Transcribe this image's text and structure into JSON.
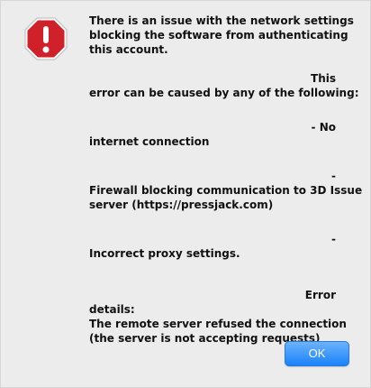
{
  "icon": {
    "name": "stop-alert-icon",
    "color": "#d0202a"
  },
  "message": {
    "intro": [
      "There is an issue with the network settings",
      "blocking the software from authenticating",
      "this account."
    ],
    "causes_tail": "This",
    "causes_head": "error can be caused by any of the following:",
    "item1_tail": "- No",
    "item1_head": "internet connection",
    "item2_tail": "-",
    "item2_head": [
      "Firewall blocking communication to 3D Issue",
      "server (https://pressjack.com)"
    ],
    "item3_tail": "-",
    "item3_head": "Incorrect proxy settings.",
    "details_tail": "Error",
    "details_head": "details:",
    "details_body": [
      "The remote server refused the connection",
      "(the server is not accepting requests)"
    ]
  },
  "buttons": {
    "ok_label": "OK"
  }
}
